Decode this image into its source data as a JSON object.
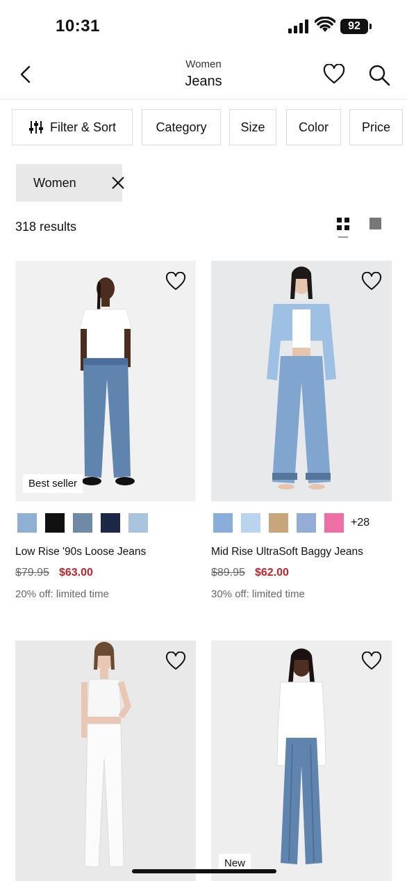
{
  "status": {
    "time": "10:31",
    "battery": "92"
  },
  "header": {
    "subtitle": "Women",
    "title": "Jeans"
  },
  "filters": {
    "filter_sort": "Filter & Sort",
    "category": "Category",
    "size": "Size",
    "color": "Color",
    "price": "Price"
  },
  "active_filter": {
    "label": "Women"
  },
  "results": {
    "count_text": "318 results"
  },
  "products": [
    {
      "badge": "Best seller",
      "swatches": [
        "#8fb0d2",
        "#111111",
        "#6f8aa6",
        "#1d2747",
        "#a9c3dc"
      ],
      "more": "",
      "name": "Low Rise '90s Loose Jeans",
      "old_price": "$79.95",
      "price": "$63.00",
      "promo": "20% off: limited time"
    },
    {
      "badge": "",
      "swatches": [
        "#8aaedb",
        "#b8d4ef",
        "#c9a57c",
        "#94acd8",
        "#ee6fa5"
      ],
      "more": "+28",
      "name": "Mid Rise UltraSoft Baggy Jeans",
      "old_price": "$89.95",
      "price": "$62.00",
      "promo": "30% off: limited time"
    },
    {
      "badge": ""
    },
    {
      "badge": "New"
    }
  ]
}
